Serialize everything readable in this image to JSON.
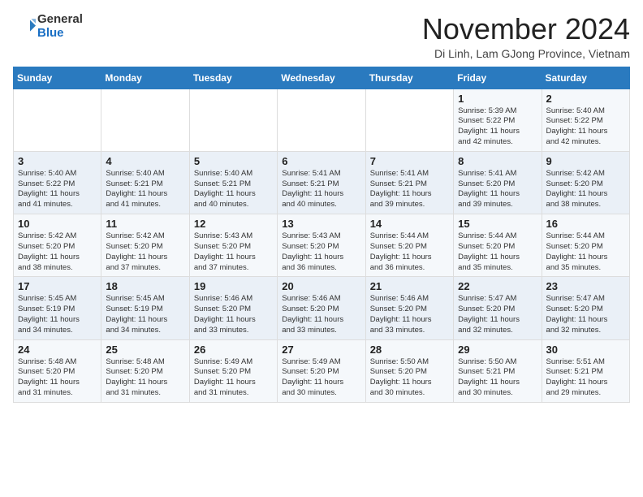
{
  "logo": {
    "general": "General",
    "blue": "Blue"
  },
  "title": "November 2024",
  "location": "Di Linh, Lam GJong Province, Vietnam",
  "weekdays": [
    "Sunday",
    "Monday",
    "Tuesday",
    "Wednesday",
    "Thursday",
    "Friday",
    "Saturday"
  ],
  "weeks": [
    [
      {
        "day": "",
        "info": ""
      },
      {
        "day": "",
        "info": ""
      },
      {
        "day": "",
        "info": ""
      },
      {
        "day": "",
        "info": ""
      },
      {
        "day": "",
        "info": ""
      },
      {
        "day": "1",
        "info": "Sunrise: 5:39 AM\nSunset: 5:22 PM\nDaylight: 11 hours\nand 42 minutes."
      },
      {
        "day": "2",
        "info": "Sunrise: 5:40 AM\nSunset: 5:22 PM\nDaylight: 11 hours\nand 42 minutes."
      }
    ],
    [
      {
        "day": "3",
        "info": "Sunrise: 5:40 AM\nSunset: 5:22 PM\nDaylight: 11 hours\nand 41 minutes."
      },
      {
        "day": "4",
        "info": "Sunrise: 5:40 AM\nSunset: 5:21 PM\nDaylight: 11 hours\nand 41 minutes."
      },
      {
        "day": "5",
        "info": "Sunrise: 5:40 AM\nSunset: 5:21 PM\nDaylight: 11 hours\nand 40 minutes."
      },
      {
        "day": "6",
        "info": "Sunrise: 5:41 AM\nSunset: 5:21 PM\nDaylight: 11 hours\nand 40 minutes."
      },
      {
        "day": "7",
        "info": "Sunrise: 5:41 AM\nSunset: 5:21 PM\nDaylight: 11 hours\nand 39 minutes."
      },
      {
        "day": "8",
        "info": "Sunrise: 5:41 AM\nSunset: 5:20 PM\nDaylight: 11 hours\nand 39 minutes."
      },
      {
        "day": "9",
        "info": "Sunrise: 5:42 AM\nSunset: 5:20 PM\nDaylight: 11 hours\nand 38 minutes."
      }
    ],
    [
      {
        "day": "10",
        "info": "Sunrise: 5:42 AM\nSunset: 5:20 PM\nDaylight: 11 hours\nand 38 minutes."
      },
      {
        "day": "11",
        "info": "Sunrise: 5:42 AM\nSunset: 5:20 PM\nDaylight: 11 hours\nand 37 minutes."
      },
      {
        "day": "12",
        "info": "Sunrise: 5:43 AM\nSunset: 5:20 PM\nDaylight: 11 hours\nand 37 minutes."
      },
      {
        "day": "13",
        "info": "Sunrise: 5:43 AM\nSunset: 5:20 PM\nDaylight: 11 hours\nand 36 minutes."
      },
      {
        "day": "14",
        "info": "Sunrise: 5:44 AM\nSunset: 5:20 PM\nDaylight: 11 hours\nand 36 minutes."
      },
      {
        "day": "15",
        "info": "Sunrise: 5:44 AM\nSunset: 5:20 PM\nDaylight: 11 hours\nand 35 minutes."
      },
      {
        "day": "16",
        "info": "Sunrise: 5:44 AM\nSunset: 5:20 PM\nDaylight: 11 hours\nand 35 minutes."
      }
    ],
    [
      {
        "day": "17",
        "info": "Sunrise: 5:45 AM\nSunset: 5:19 PM\nDaylight: 11 hours\nand 34 minutes."
      },
      {
        "day": "18",
        "info": "Sunrise: 5:45 AM\nSunset: 5:19 PM\nDaylight: 11 hours\nand 34 minutes."
      },
      {
        "day": "19",
        "info": "Sunrise: 5:46 AM\nSunset: 5:20 PM\nDaylight: 11 hours\nand 33 minutes."
      },
      {
        "day": "20",
        "info": "Sunrise: 5:46 AM\nSunset: 5:20 PM\nDaylight: 11 hours\nand 33 minutes."
      },
      {
        "day": "21",
        "info": "Sunrise: 5:46 AM\nSunset: 5:20 PM\nDaylight: 11 hours\nand 33 minutes."
      },
      {
        "day": "22",
        "info": "Sunrise: 5:47 AM\nSunset: 5:20 PM\nDaylight: 11 hours\nand 32 minutes."
      },
      {
        "day": "23",
        "info": "Sunrise: 5:47 AM\nSunset: 5:20 PM\nDaylight: 11 hours\nand 32 minutes."
      }
    ],
    [
      {
        "day": "24",
        "info": "Sunrise: 5:48 AM\nSunset: 5:20 PM\nDaylight: 11 hours\nand 31 minutes."
      },
      {
        "day": "25",
        "info": "Sunrise: 5:48 AM\nSunset: 5:20 PM\nDaylight: 11 hours\nand 31 minutes."
      },
      {
        "day": "26",
        "info": "Sunrise: 5:49 AM\nSunset: 5:20 PM\nDaylight: 11 hours\nand 31 minutes."
      },
      {
        "day": "27",
        "info": "Sunrise: 5:49 AM\nSunset: 5:20 PM\nDaylight: 11 hours\nand 30 minutes."
      },
      {
        "day": "28",
        "info": "Sunrise: 5:50 AM\nSunset: 5:20 PM\nDaylight: 11 hours\nand 30 minutes."
      },
      {
        "day": "29",
        "info": "Sunrise: 5:50 AM\nSunset: 5:21 PM\nDaylight: 11 hours\nand 30 minutes."
      },
      {
        "day": "30",
        "info": "Sunrise: 5:51 AM\nSunset: 5:21 PM\nDaylight: 11 hours\nand 29 minutes."
      }
    ]
  ]
}
